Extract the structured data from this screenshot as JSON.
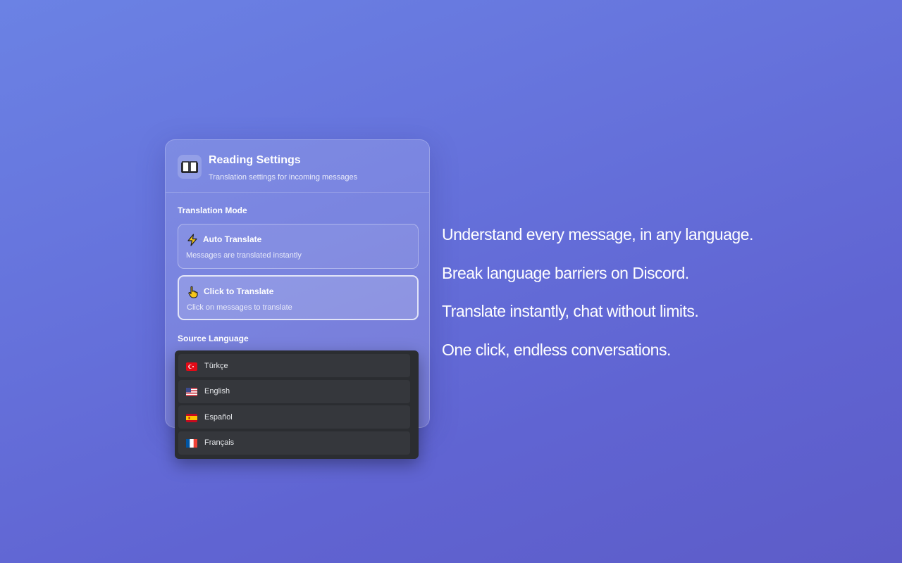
{
  "panel": {
    "title": "Reading Settings",
    "subtitle": "Translation settings for incoming messages",
    "header_icon": "book-icon"
  },
  "translation_mode": {
    "label": "Translation Mode",
    "options": [
      {
        "title": "Auto Translate",
        "description": "Messages are translated instantly",
        "icon": "lightning-icon",
        "selected": false
      },
      {
        "title": "Click to Translate",
        "description": "Click on messages to translate",
        "icon": "pointing-hand-icon",
        "selected": true
      }
    ]
  },
  "source_language": {
    "label": "Source Language",
    "options": [
      {
        "label": "Türkçe",
        "flag": "turkey-flag-icon"
      },
      {
        "label": "English",
        "flag": "usa-flag-icon"
      },
      {
        "label": "Español",
        "flag": "spain-flag-icon"
      },
      {
        "label": "Français",
        "flag": "france-flag-icon"
      }
    ]
  },
  "taglines": [
    "Understand every message, in any language.",
    "Break language barriers on Discord.",
    "Translate instantly, chat without limits.",
    "One click, endless conversations."
  ],
  "colors": {
    "background_start": "#6b82e4",
    "background_end": "#5d5cc8",
    "dropdown_bg": "#2b2d31",
    "dropdown_item_bg": "#35373c"
  }
}
